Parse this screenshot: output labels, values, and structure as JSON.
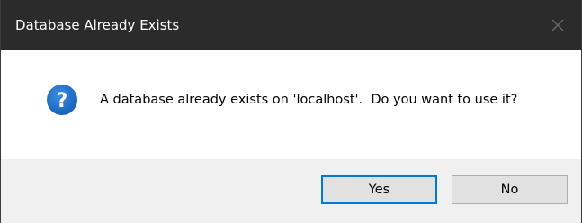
{
  "window": {
    "title": "Database Already Exists"
  },
  "content": {
    "icon": "question-icon",
    "message": "A database already exists on 'localhost'.  Do you want to use it?"
  },
  "buttons": {
    "yes_label": "Yes",
    "no_label": "No"
  },
  "colors": {
    "titlebar": "#2b2b2b",
    "icon_blue": "#1a6fc6",
    "default_button_border": "#0078d7",
    "footer": "#f0f0f0"
  }
}
